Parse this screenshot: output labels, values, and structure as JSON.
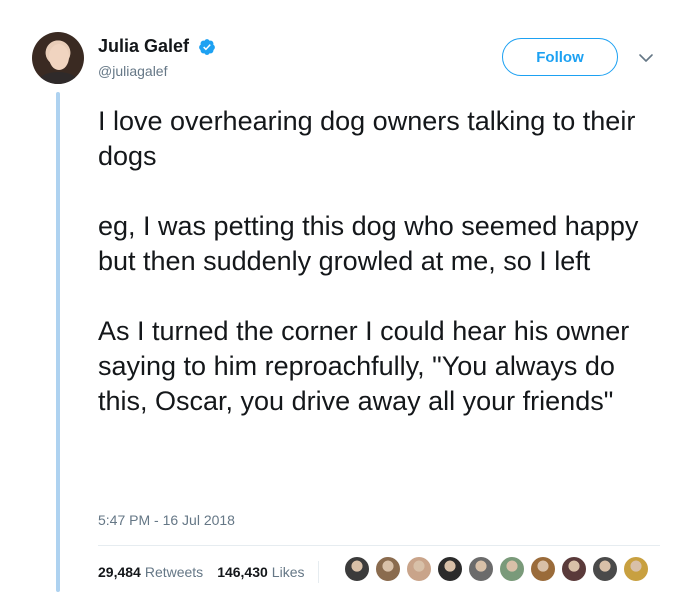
{
  "tweet": {
    "author": {
      "display_name": "Julia Galef",
      "handle": "@juliagalef",
      "verified": true
    },
    "follow_label": "Follow",
    "text_paragraphs": [
      "I love overhearing dog owners talking to their dogs",
      "eg, I was petting this dog who seemed happy but then suddenly growled at me, so I left",
      "As I turned the corner I could hear his owner saying to him reproachfully, \"You always do this, Oscar, you drive away all your friends\""
    ],
    "timestamp": "5:47 PM - 16 Jul 2018",
    "stats": {
      "retweets_count": "29,484",
      "retweets_label": "Retweets",
      "likes_count": "146,430",
      "likes_label": "Likes"
    },
    "liker_avatar_colors": [
      "#3b3b3b",
      "#8a6b4e",
      "#c9a48a",
      "#2b2b2b",
      "#6b6b6b",
      "#7a9a7a",
      "#9a6b3a",
      "#5a3a3a",
      "#4a4a4a",
      "#c8a040"
    ]
  },
  "colors": {
    "accent": "#1da1f2",
    "thread_line": "#aed2f0",
    "secondary_text": "#657786"
  }
}
